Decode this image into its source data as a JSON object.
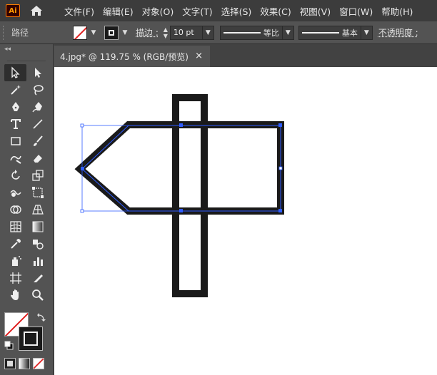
{
  "app": {
    "logo_text": "Ai"
  },
  "menu": [
    "文件(F)",
    "编辑(E)",
    "对象(O)",
    "文字(T)",
    "选择(S)",
    "效果(C)",
    "视图(V)",
    "窗口(W)",
    "帮助(H)"
  ],
  "control": {
    "selection_label": "路径",
    "stroke_label": "描边 :",
    "stroke_value": "10 pt",
    "profile_uniform": "等比",
    "brush_basic": "基本",
    "opacity_label": "不透明度 :"
  },
  "toolbar": {
    "collapse_label": "◂◂"
  },
  "document": {
    "tab_title": "4.jpg* @ 119.75 % (RGB/预览)",
    "close_symbol": "×"
  },
  "colors": {
    "accent_selection": "#2f5cff",
    "shape_fill": "#1a1a1a",
    "fill_none_slash": "#e02020"
  }
}
